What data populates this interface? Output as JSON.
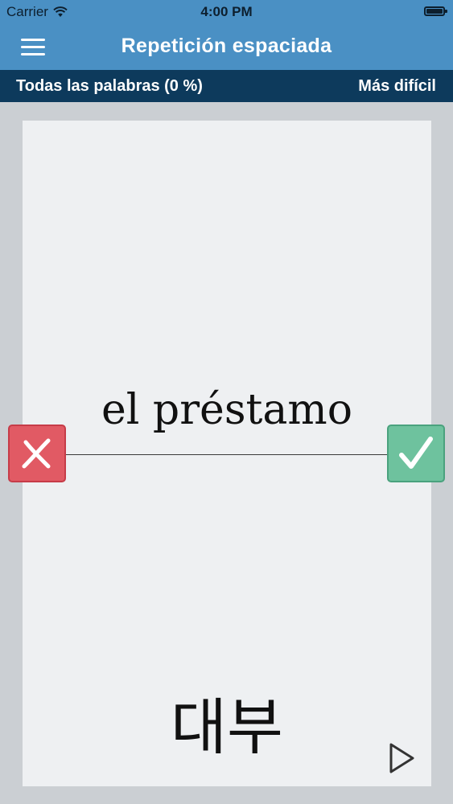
{
  "status_bar": {
    "carrier": "Carrier",
    "time": "4:00 PM"
  },
  "nav": {
    "title": "Repetición espaciada",
    "menu_icon": "hamburger-menu-icon"
  },
  "subbar": {
    "filter_label": "Todas las palabras (0 %)",
    "sort_label": "Más difícil"
  },
  "card": {
    "front_text": "el préstamo",
    "back_text": "대부"
  },
  "actions": {
    "wrong_icon": "x-icon",
    "right_icon": "checkmark-icon",
    "play_icon": "play-icon"
  },
  "colors": {
    "nav_bg": "#4a90c4",
    "subbar_bg": "#0d3a5c",
    "wrong": "#e15a64",
    "right": "#6ec29e",
    "card_bg": "#eef0f2"
  }
}
